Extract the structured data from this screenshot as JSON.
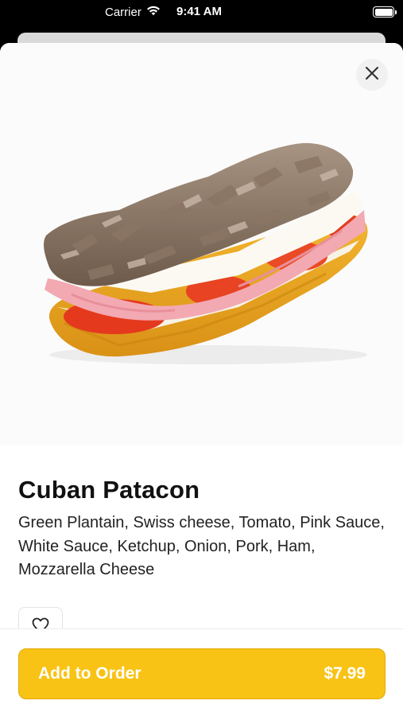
{
  "status_bar": {
    "carrier": "Carrier",
    "time": "9:41 AM",
    "icons": [
      "wifi-icon",
      "battery-icon"
    ]
  },
  "product": {
    "image": "sandwich-photo",
    "title": "Cuban Patacon",
    "description": "Green Plantain, Swiss cheese, Tomato, Pink Sauce, White Sauce, Ketchup, Onion, Pork, Ham,  Mozzarella Cheese"
  },
  "actions": {
    "close_icon": "close-icon",
    "favorite_icon": "heart-icon",
    "add_label": "Add to Order",
    "price": "$7.99"
  },
  "colors": {
    "accent": "#f8c315",
    "text": "#111111",
    "background": "#ffffff"
  }
}
